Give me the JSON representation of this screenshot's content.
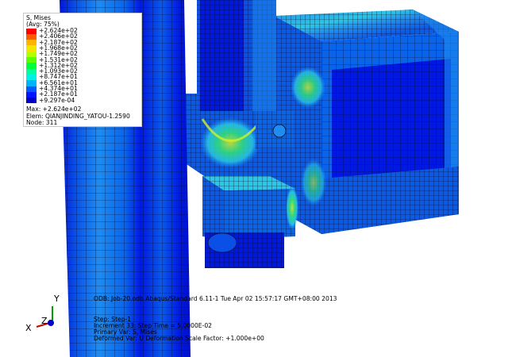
{
  "legend": {
    "title": "S, Mises",
    "subtitle": "(Avg: 75%)",
    "entries": [
      {
        "label": "+2.624e+02",
        "color": "#ff0000"
      },
      {
        "label": "+2.406e+02",
        "color": "#ff5a00"
      },
      {
        "label": "+2.187e+02",
        "color": "#ffb400"
      },
      {
        "label": "+1.968e+02",
        "color": "#f0e600"
      },
      {
        "label": "+1.749e+02",
        "color": "#b4ff00"
      },
      {
        "label": "+1.531e+02",
        "color": "#5aff00"
      },
      {
        "label": "+1.312e+02",
        "color": "#00ff3c"
      },
      {
        "label": "+1.093e+02",
        "color": "#00ffa0"
      },
      {
        "label": "+8.747e+01",
        "color": "#00f0e6"
      },
      {
        "label": "+6.561e+01",
        "color": "#00b4ff"
      },
      {
        "label": "+4.374e+01",
        "color": "#005aff"
      },
      {
        "label": "+2.187e+01",
        "color": "#0014ff"
      },
      {
        "label": "+9.297e-04",
        "color": "#0000c8"
      }
    ],
    "max_line": "Max: +2.624e+02",
    "elem_line": "Elem: QIANJINDING_YATOU-1.2590",
    "node_line": "Node: 311"
  },
  "status": {
    "odb_line": "ODB: Job-20.odb    Abaqus/Standard 6.11-1    Tue Apr 02 15:57:17 GMT+08:00 2013",
    "step_line": "Step: Step-1",
    "increment_line": "Increment    33: Step Time =    5.0000E-02",
    "primary_var_line": "Primary Var: S, Mises",
    "deformed_var_line": "Deformed Var: U   Deformation Scale Factor: +1.000e+00"
  },
  "triad": {
    "x": "X",
    "y": "Y",
    "z": "Z"
  },
  "colors": {
    "background": "#ffffff",
    "mesh_line": "#0a0a28",
    "deep_blue": "#0018e0",
    "mid_blue": "#0a5ae8",
    "light_blue": "#1e8cf0",
    "cyan": "#28c8e6",
    "green": "#32e678",
    "yellow": "#d2f028"
  }
}
